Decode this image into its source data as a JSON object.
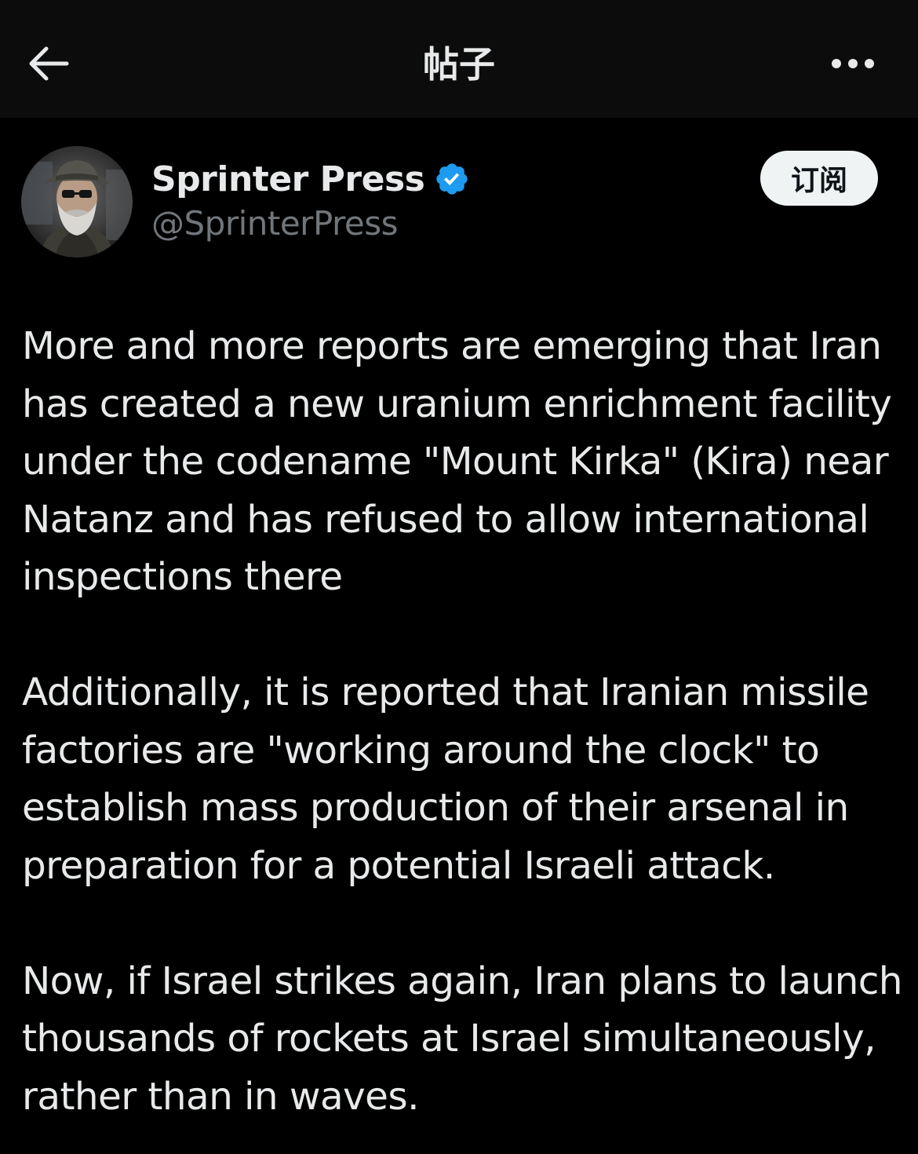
{
  "topbar": {
    "title": "帖子",
    "back_icon": "arrow-left-icon",
    "more_icon": "more-horizontal-icon"
  },
  "author": {
    "name": "Sprinter Press",
    "handle": "@SprinterPress",
    "verified_color": "#1d9bf0"
  },
  "subscribe": {
    "label": "订阅"
  },
  "post": {
    "paragraphs": [
      "More and more reports are emerging that Iran has created a new uranium enrichment facility under the codename \"Mount Kirka\" (Kira) near Natanz and has refused to allow international inspections there",
      "Additionally, it is reported that Iranian missile factories are \"working around the clock\" to establish mass production of their arsenal in preparation for a potential Israeli attack.",
      "Now, if Israel strikes again, Iran plans to launch thousands of rockets at Israel simultaneously, rather than in waves."
    ]
  },
  "colors": {
    "background": "#000000",
    "topbar": "#0c0c0c",
    "text": "#e7e9ea",
    "muted": "#71767b",
    "accent": "#1d9bf0"
  }
}
